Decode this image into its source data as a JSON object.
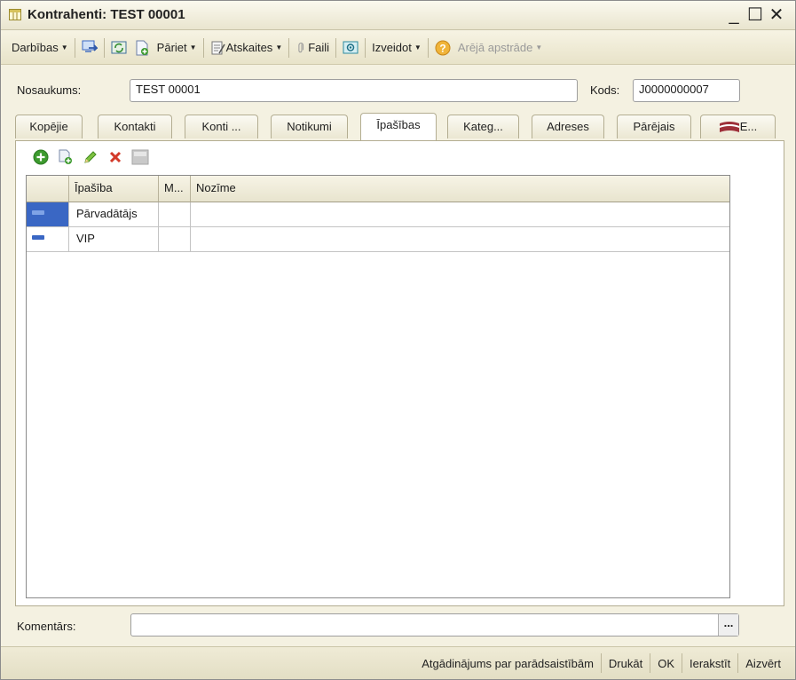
{
  "window": {
    "title": "Kontrahenti: TEST 00001",
    "controls": {
      "minimize": "_",
      "maximize": "☐",
      "close": "✕"
    }
  },
  "toolbar": {
    "actions_label": "Darbības",
    "goto_label": "Pāriet",
    "reports_label": "Atskaites",
    "files_label": "Faili",
    "create_label": "Izveidot",
    "external_label": "Arējā apstrāde"
  },
  "form": {
    "name_label": "Nosaukums:",
    "name_value": "TEST 00001",
    "code_label": "Kods:",
    "code_value": "J0000000007",
    "comment_label": "Komentārs:",
    "comment_value": "",
    "comment_button": "..."
  },
  "tabs": [
    {
      "label": "Kopējie"
    },
    {
      "label": "Kontakti"
    },
    {
      "label": "Konti ..."
    },
    {
      "label": "Notikumi"
    },
    {
      "label": "Īpašības",
      "active": true
    },
    {
      "label": "Kateg..."
    },
    {
      "label": "Adreses"
    },
    {
      "label": "Pārējais"
    },
    {
      "label": "E..."
    }
  ],
  "grid": {
    "columns": [
      "Īpašība",
      "M...",
      "Nozīme"
    ],
    "rows": [
      {
        "property": "Pārvadātājs",
        "m": "",
        "value": "",
        "selected": true
      },
      {
        "property": "VIP",
        "m": "",
        "value": "",
        "selected": false
      }
    ]
  },
  "footer": {
    "reminder_label": "Atgādinājums par parādsaistībām",
    "print_label": "Drukāt",
    "ok_label": "OK",
    "write_label": "Ierakstīt",
    "close_label": "Aizvērt"
  },
  "colors": {
    "accent_blue": "#3a67c4",
    "add_green": "#3c9a2e",
    "delete_red": "#d33a2a",
    "flag_red": "#9e3039"
  }
}
